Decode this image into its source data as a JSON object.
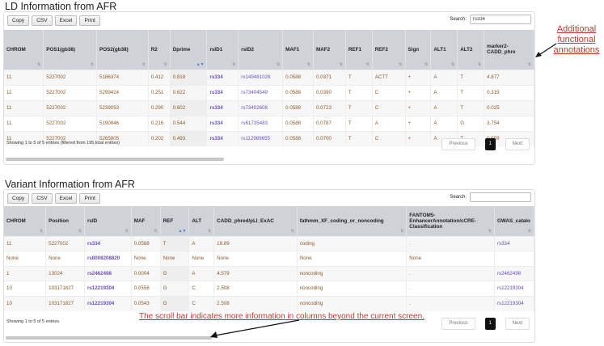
{
  "ld": {
    "title": "LD Information from AFR",
    "buttons": [
      "Copy",
      "CSV",
      "Excel",
      "Print"
    ],
    "search_label": "Search:",
    "search_value": "rs334",
    "columns": [
      "CHROM",
      "POS1(gb38)",
      "POS2(gb38)",
      "R2",
      "Dprime",
      "rsID1",
      "rsID2",
      "MAF1",
      "MAF2",
      "REF1",
      "REF2",
      "Sign",
      "ALT1",
      "ALT2",
      "marker2-CADD_phre"
    ],
    "rows": [
      [
        "11",
        "5227002",
        "5186374",
        "0.412",
        "0.818",
        "rs334",
        "rs149481026",
        "0.0588",
        "0.0371",
        "T",
        "ACTT",
        "+",
        "A",
        "T",
        "4.877"
      ],
      [
        "11",
        "5227002",
        "5299424",
        "0.251",
        "0.622",
        "rs334",
        "rs73404549",
        "0.0588",
        "0.0390",
        "T",
        "C",
        "+",
        "A",
        "T",
        "0.319"
      ],
      [
        "11",
        "5227002",
        "5239053",
        "0.290",
        "0.602",
        "rs334",
        "rs73402608",
        "0.0588",
        "0.0723",
        "T",
        "C",
        "+",
        "A",
        "T",
        "0.025"
      ],
      [
        "11",
        "5227002",
        "5190846",
        "0.216",
        "0.544",
        "rs334",
        "rs61735483",
        "0.0588",
        "0.0787",
        "T",
        "A",
        "+",
        "A",
        "G",
        "3.754"
      ],
      [
        "11",
        "5227002",
        "5265805",
        "0.202",
        "0.493",
        "rs334",
        "rs112989655",
        "0.0588",
        "0.0700",
        "T",
        "C",
        "+",
        "A",
        "T",
        "0.559"
      ]
    ],
    "info": "Showing 1 to 5 of 5 entries (filtered from 195 total entries)",
    "prev": "Previous",
    "page": "1",
    "next": "Next"
  },
  "variant": {
    "title": "Variant Information from AFR",
    "buttons": [
      "Copy",
      "CSV",
      "Excel",
      "Print"
    ],
    "search_label": "Search:",
    "search_value": "",
    "columns": [
      "CHROM",
      "Position",
      "rsID",
      "MAF",
      "REF",
      "ALT",
      "CADD_phred/pLI_ExAC",
      "fathmm_XF_coding_or_noncoding",
      "FANTOM5-EnhancerAnnotation/cCRE-Classification",
      "GWAS_catalo"
    ],
    "rows": [
      [
        "11",
        "5227002",
        "rs334",
        "0.0588",
        "T",
        "A",
        "18.89",
        "coding",
        ".",
        "rs334"
      ],
      [
        "None",
        "None",
        "rs8008208820",
        "None",
        "None",
        "None",
        "None",
        "None",
        "None",
        ""
      ],
      [
        "1",
        "13024",
        "rs2462498",
        "0.0004",
        "G",
        "A",
        "4.579",
        "noncoding",
        ".",
        "rs2462498"
      ],
      [
        "10",
        "103171827",
        "rs12219304",
        "0.0558",
        "G",
        "C",
        "2.508",
        "noncoding",
        ".",
        "rs12219304"
      ],
      [
        "10",
        "103171827",
        "rs12219304",
        "0.0543",
        "G",
        "C",
        "2.508",
        "noncoding",
        ".",
        "rs12219304"
      ]
    ],
    "info": "Showing 1 to 5 of 5 entries",
    "prev": "Previous",
    "page": "1",
    "next": "Next"
  },
  "annotations": {
    "functional": "Additional functional annotations",
    "scroll": "The scroll bar indicates more information in columns beyond the current screen."
  },
  "colors": {
    "accent_red": "#c0392b",
    "link_purple": "#6a4fbf",
    "number_brown": "#8a5a2b",
    "header_gray": "#cfd3d7"
  }
}
